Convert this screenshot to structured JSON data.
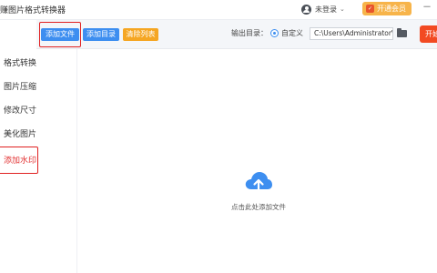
{
  "app": {
    "title": "赚图片格式转换器"
  },
  "header": {
    "user_label": "未登录",
    "vip_label": "开通会员",
    "minimize": "－"
  },
  "sidebar": {
    "items": [
      {
        "label": "格式转换"
      },
      {
        "label": "图片压缩"
      },
      {
        "label": "修改尺寸"
      },
      {
        "label": "美化图片"
      },
      {
        "label": "添加水印"
      }
    ]
  },
  "toolbar": {
    "add_file": "添加文件",
    "add_dir": "添加目录",
    "clear_list": "清除列表",
    "output_label": "输出目录：",
    "custom_label": "自定义",
    "path_value": "C:\\Users\\Administrator\\",
    "start_label": "开始"
  },
  "main": {
    "drop_hint": "点击此处添加文件"
  },
  "colors": {
    "primary_blue": "#3d8ef0",
    "clear_orange": "#f5a623",
    "start_red": "#f24a22",
    "highlight_red": "#e02020"
  }
}
